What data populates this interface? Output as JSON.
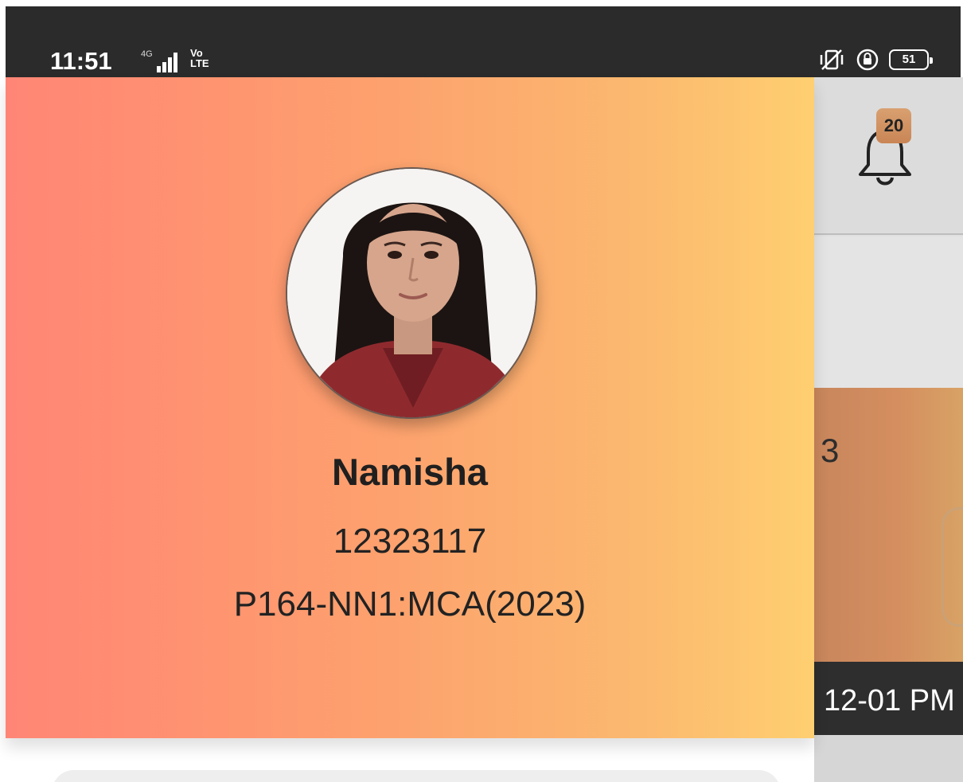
{
  "status_bar": {
    "time": "11:51",
    "network": "4G",
    "volte": "Vo\nLTE",
    "battery": "51"
  },
  "profile": {
    "name": "Namisha",
    "id": "12323117",
    "program": "P164-NN1:MCA(2023)"
  },
  "background_app": {
    "notification_count": "20",
    "card_value": "3",
    "time_slot": "12-01 PM"
  },
  "colors": {
    "gradient_start": "#ff8676",
    "gradient_end": "#ffcf70",
    "status_bar": "#2b2b2b"
  }
}
